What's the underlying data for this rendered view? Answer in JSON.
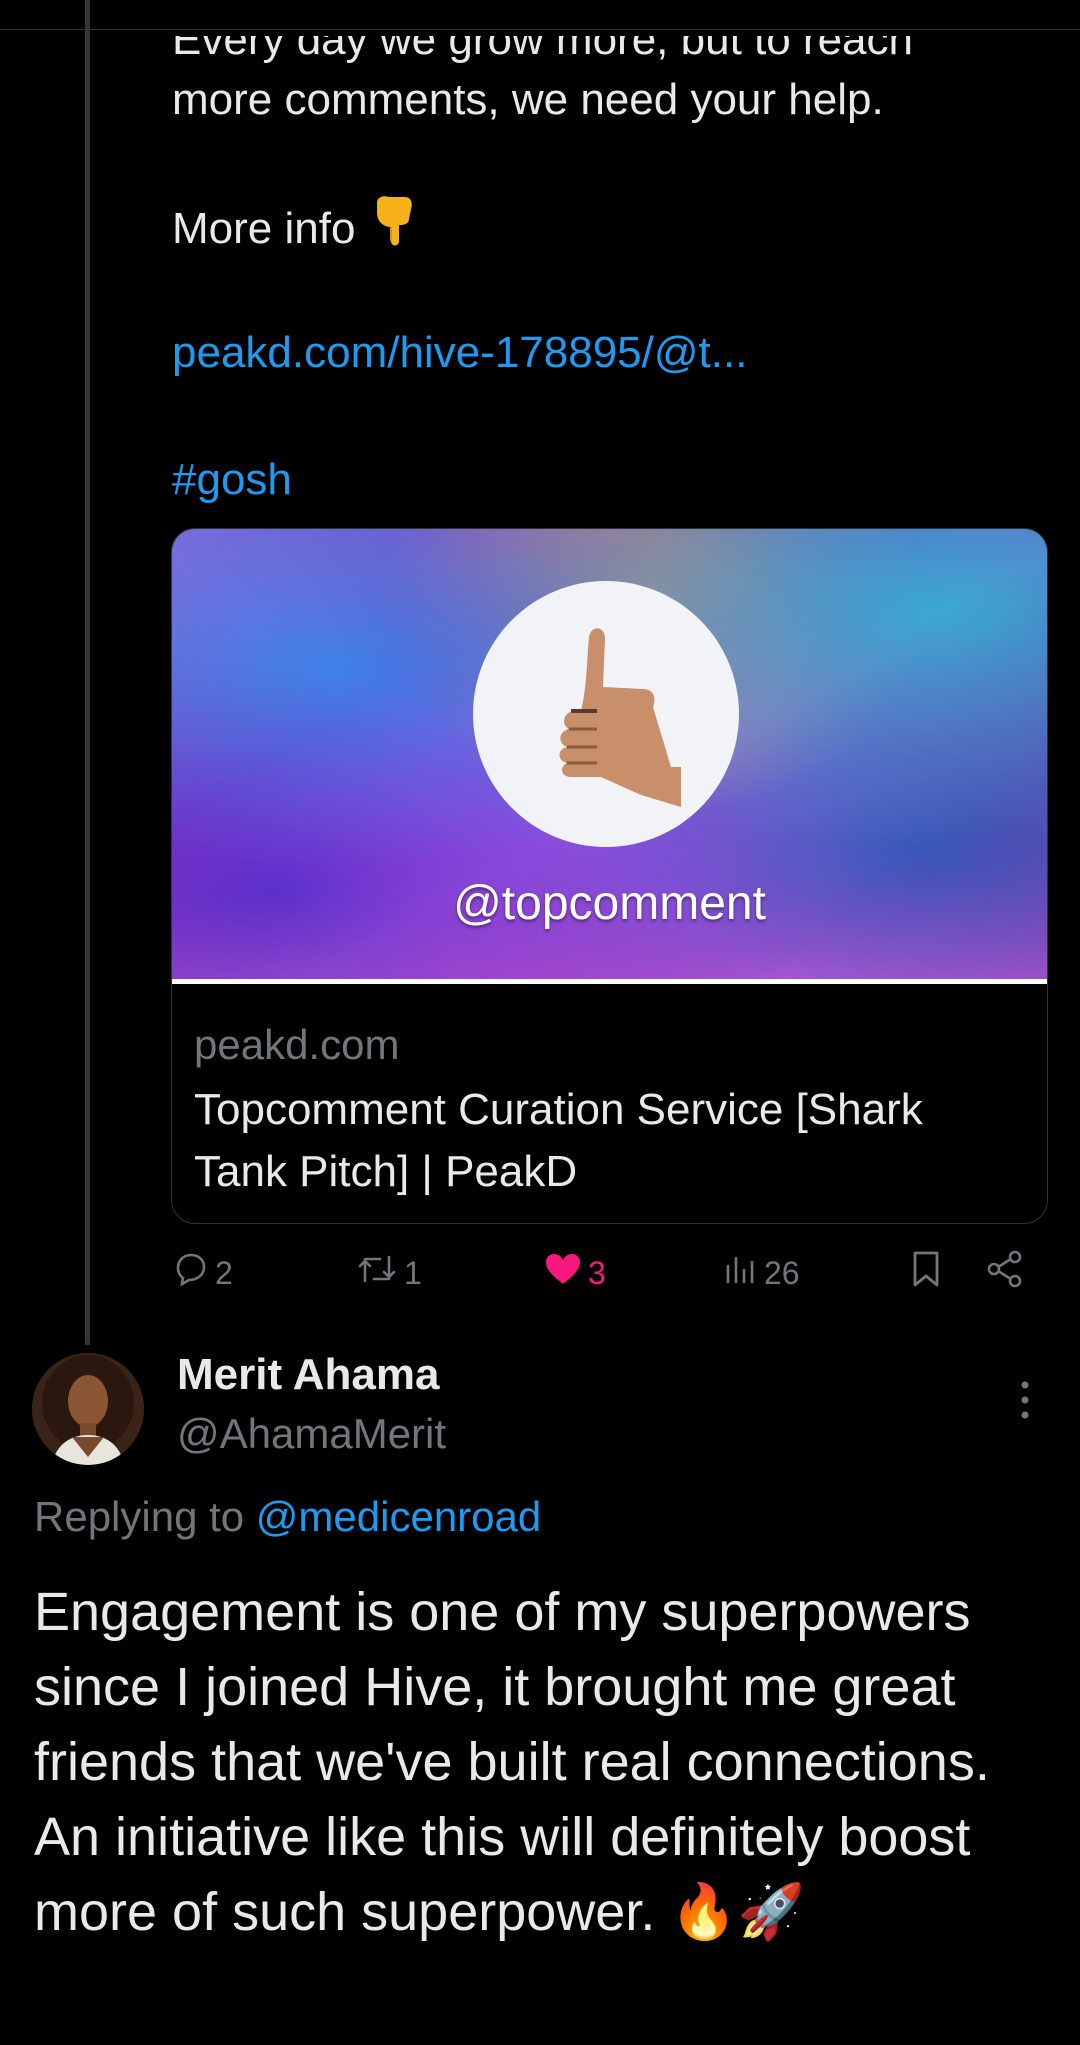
{
  "tweet": {
    "line_cut": "Every day we grow more, but to reach",
    "line2": "more comments, we need your help.",
    "more_info": "More info",
    "link": "peakd.com/hive-178895/@t...",
    "hashtag": "#gosh",
    "card": {
      "image_handle": "@topcomment",
      "domain": "peakd.com",
      "title": "Topcomment Curation Service [Shark Tank Pitch] | PeakD"
    },
    "actions": {
      "replies": "2",
      "retweets": "1",
      "likes": "3",
      "views": "26"
    },
    "colors": {
      "link": "#1d9bf0",
      "like": "#f91880",
      "muted": "#71767b"
    }
  },
  "reply": {
    "name": "Merit Ahama",
    "handle": "@AhamaMerit",
    "replying_label": "Replying to",
    "replying_to": "@medicenroad",
    "text": "Engagement is one of my superpowers since I joined Hive, it brought me great friends that we've built real connections. An initiative like this will definitely boost more of such superpower. 🔥🚀"
  }
}
